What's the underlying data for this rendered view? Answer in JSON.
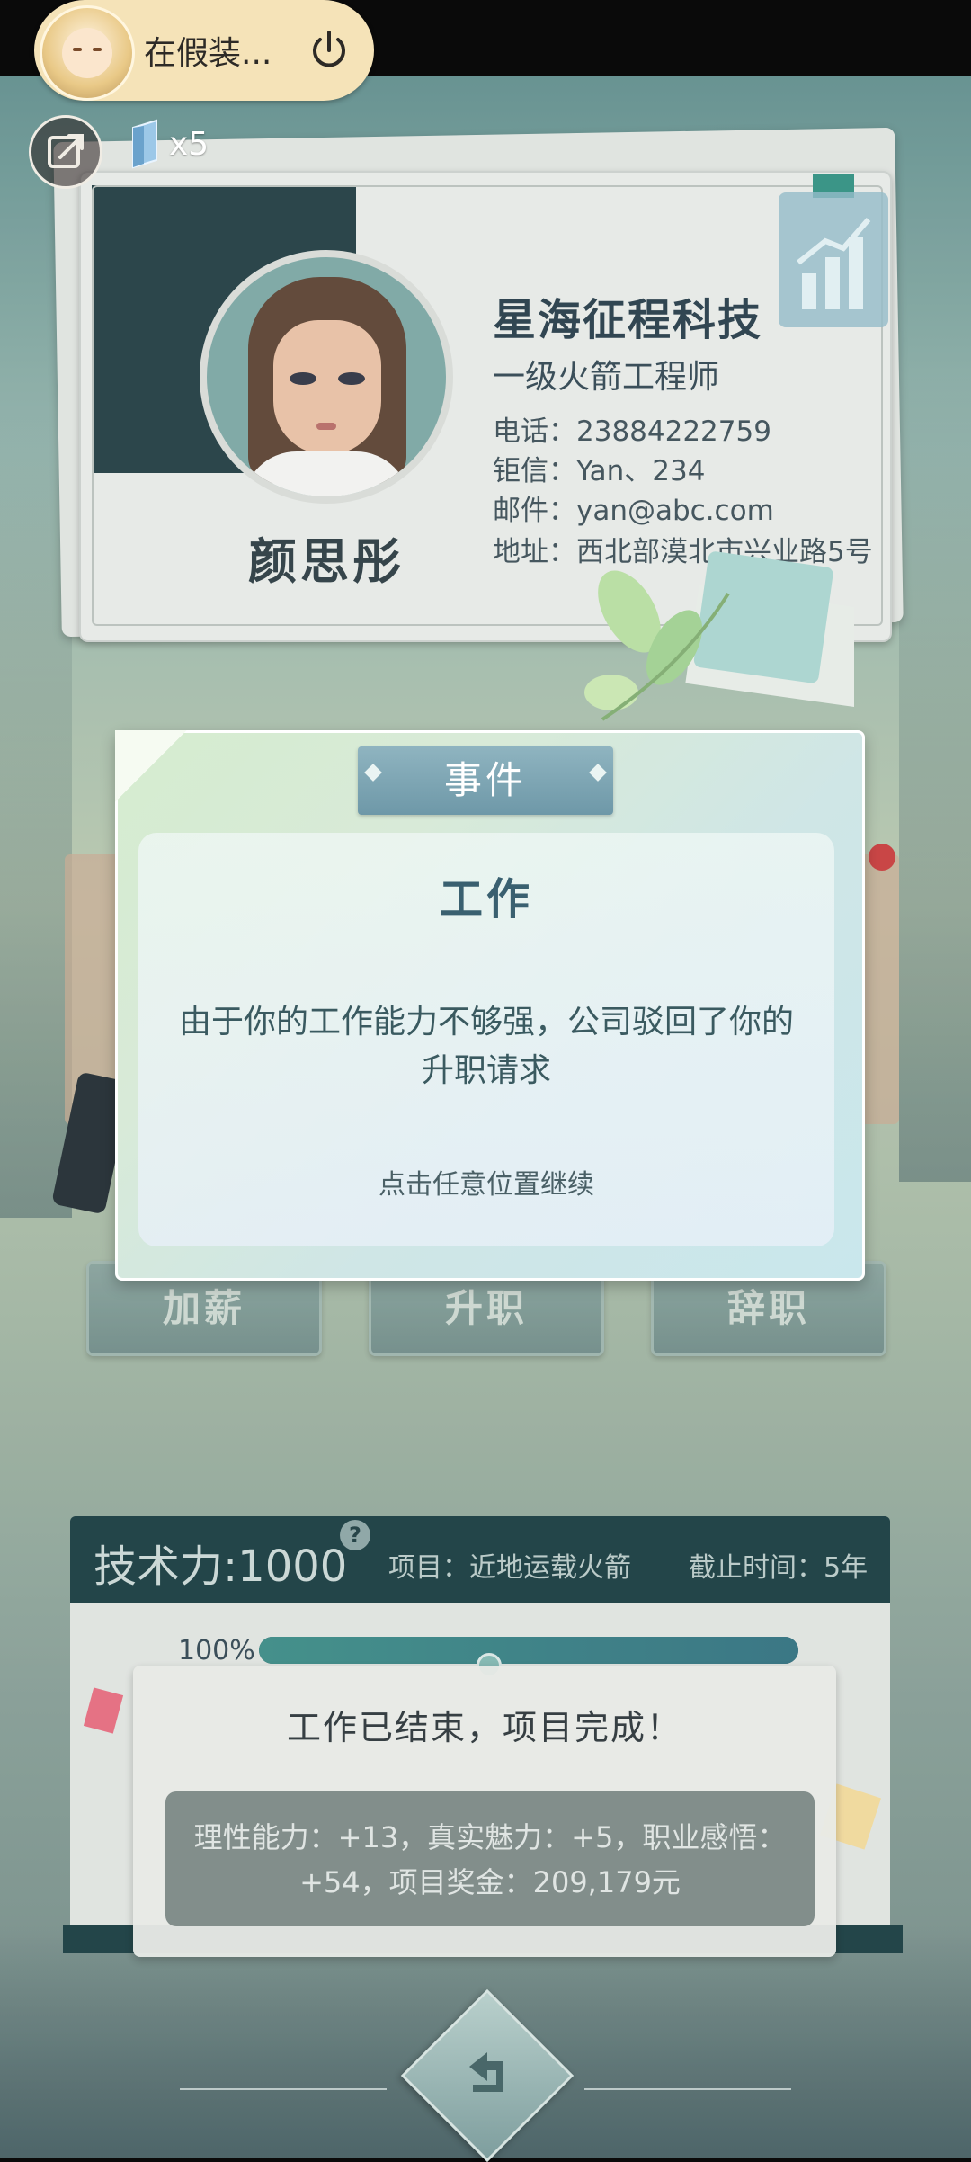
{
  "status_bar": {
    "app_label": "在假装...",
    "icons": [
      "app-avatar-icon",
      "power-icon"
    ]
  },
  "top_bar": {
    "exit_icon": "exit-icon",
    "gem_icon": "diamond-gem-icon",
    "gem_count": "x5"
  },
  "profile": {
    "name": "颜思彤",
    "company": "星海征程科技",
    "job_title": "一级火箭工程师",
    "phone": "电话：23884222759",
    "messenger": "钜信：Yan、234",
    "email": "邮件：yan@abc.com",
    "address": "地址：西北部漠北市兴业路5号",
    "badge_icon": "growth-chart-icon"
  },
  "actions": {
    "raise": "加薪",
    "promote": "升职",
    "resign": "辞职"
  },
  "event_modal": {
    "header": "事件",
    "title": "工作",
    "message": "由于你的工作能力不够强，公司驳回了你的升职请求",
    "hint": "点击任意位置继续"
  },
  "project": {
    "score": "技术力:1000",
    "help_icon": "?",
    "name": "项目：近地运载火箭",
    "deadline": "截止时间：5年",
    "progress_label": "100%",
    "progress_value": 1.0,
    "result_title": "工作已结束，项目完成！",
    "rewards": "理性能力：+13，真实魅力：+5，职业感悟：+54，项目奖金：209,179元"
  },
  "navigation": {
    "back_icon": "back-arrow-icon"
  },
  "colors": {
    "accent": "#163a3e",
    "modal_header": "#6e98a8",
    "progress": "#3a8a84"
  }
}
